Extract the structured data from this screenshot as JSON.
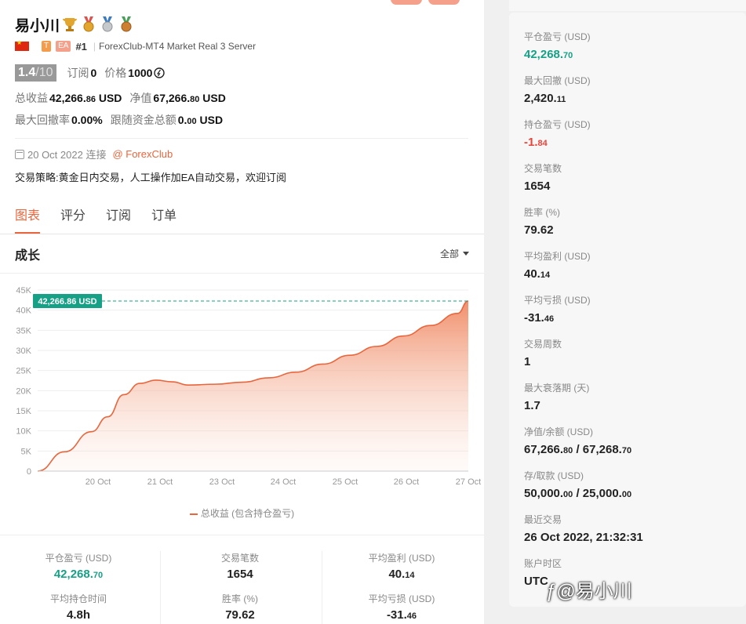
{
  "profile": {
    "name": "易小川",
    "rank": "#1",
    "tag_t": "T",
    "tag_ea": "EA",
    "server": "ForexClub-MT4 Market Real 3 Server",
    "rating_value": "1.4",
    "rating_denom": "/10",
    "subscribe_label": "订阅",
    "subscribe_count": "0",
    "price_label": "价格",
    "price_value": "1000",
    "total_profit_label": "总收益",
    "total_profit_int": "42,266.",
    "total_profit_dec": "86",
    "total_profit_unit": "USD",
    "equity_label": "净值",
    "equity_int": "67,266.",
    "equity_dec": "80",
    "equity_unit": "USD",
    "max_drawdown_label": "最大回撤率",
    "max_drawdown_value": "0.00%",
    "follow_funds_label": "跟随资金总额",
    "follow_funds_int": "0.",
    "follow_funds_dec": "00",
    "follow_funds_unit": "USD",
    "connect_date": "20 Oct 2022 连接",
    "broker_link": "@ ForexClub",
    "strategy": "交易策略:黄金日内交易，人工操作加EA自动交易，欢迎订阅"
  },
  "tabs": [
    "图表",
    "评分",
    "订阅",
    "订单"
  ],
  "section": {
    "title": "成长",
    "filter": "全部"
  },
  "chart_data": {
    "type": "area",
    "x": [
      "19 Oct",
      "19.5 Oct",
      "20 Oct",
      "20.3 Oct",
      "20.6 Oct",
      "20.9 Oct",
      "21.2 Oct",
      "21.5 Oct",
      "21.8 Oct",
      "22.3 Oct",
      "22.8 Oct",
      "23.3 Oct",
      "23.8 Oct",
      "24.3 Oct",
      "24.8 Oct",
      "25.3 Oct",
      "25.8 Oct",
      "26.3 Oct",
      "26.8 Oct",
      "27 Oct"
    ],
    "tick_labels": [
      "20 Oct",
      "21 Oct",
      "23 Oct",
      "24 Oct",
      "25 Oct",
      "26 Oct",
      "27 Oct"
    ],
    "series": [
      {
        "name": "总收益 (包含持仓盈亏)",
        "values": [
          0,
          4800,
          9800,
          13500,
          19000,
          21800,
          22600,
          22200,
          21400,
          21600,
          22100,
          23200,
          24600,
          26600,
          28800,
          31000,
          33600,
          36200,
          39200,
          42266.86
        ]
      }
    ],
    "y_ticks": [
      "0",
      "5K",
      "10K",
      "15K",
      "20K",
      "25K",
      "30K",
      "35K",
      "40K",
      "45K"
    ],
    "ylim": [
      0,
      45000
    ],
    "marker_label": "42,266.86 USD",
    "color": "#e8663d"
  },
  "bottom_stats": [
    {
      "label": "平仓盈亏 (USD)",
      "int": "42,268.",
      "dec": "70",
      "style": "green"
    },
    {
      "label": "交易笔数",
      "int": "1654",
      "dec": "",
      "style": ""
    },
    {
      "label": "平均盈利 (USD)",
      "int": "40.",
      "dec": "14",
      "style": ""
    },
    {
      "label": "平均持仓时间",
      "int": "4.8h",
      "dec": "",
      "style": ""
    },
    {
      "label": "胜率 (%)",
      "int": "79.62",
      "dec": "",
      "style": ""
    },
    {
      "label": "平均亏损 (USD)",
      "int": "-31.",
      "dec": "46",
      "style": ""
    }
  ],
  "right_stats": [
    {
      "label": "平仓盈亏 (USD)",
      "int": "42,268.",
      "dec": "70",
      "style": "green"
    },
    {
      "label": "最大回撤 (USD)",
      "int": "2,420.",
      "dec": "11",
      "style": ""
    },
    {
      "label": "持仓盈亏 (USD)",
      "int": "-1.",
      "dec": "84",
      "style": "red"
    },
    {
      "label": "交易笔数",
      "int": "1654",
      "dec": "",
      "style": ""
    },
    {
      "label": "胜率 (%)",
      "int": "79.62",
      "dec": "",
      "style": ""
    },
    {
      "label": "平均盈利 (USD)",
      "int": "40.",
      "dec": "14",
      "style": ""
    },
    {
      "label": "平均亏损 (USD)",
      "int": "-31.",
      "dec": "46",
      "style": ""
    },
    {
      "label": "交易周数",
      "int": "1",
      "dec": "",
      "style": ""
    },
    {
      "label": "最大衰落期 (天)",
      "int": "1.7",
      "dec": "",
      "style": ""
    },
    {
      "label": "净值/余额 (USD)",
      "int": "67,266.",
      "dec": "80",
      "int2": " / 67,268.",
      "dec2": "70",
      "style": ""
    },
    {
      "label": "存/取款 (USD)",
      "int": "50,000.",
      "dec": "00",
      "int2": " / 25,000.",
      "dec2": "00",
      "style": ""
    },
    {
      "label": "最近交易",
      "int": "26 Oct 2022, 21:32:31",
      "dec": "",
      "style": ""
    },
    {
      "label": "账户时区",
      "int": "UTC",
      "dec": "",
      "style": ""
    }
  ],
  "watermark": "@易小川",
  "colors": {
    "accent": "#e8663d",
    "green": "#16a085",
    "red": "#e8443a"
  }
}
